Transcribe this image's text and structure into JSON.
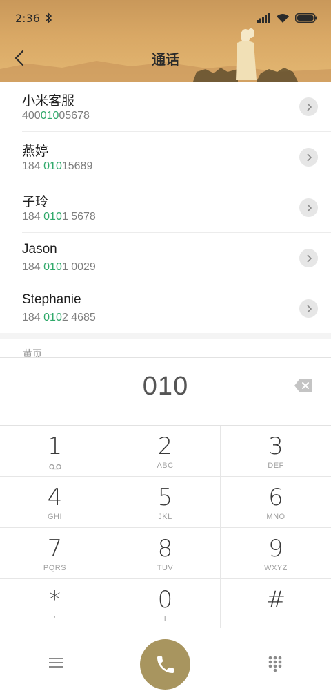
{
  "status_bar": {
    "time": "2:36"
  },
  "header": {
    "title": "通话"
  },
  "results": [
    {
      "name": "小米客服",
      "number_pre": "400",
      "number_match": "010",
      "number_post": "05678"
    },
    {
      "name": "燕婷",
      "number_pre": "184 ",
      "number_match": "010",
      "number_post": "15689"
    },
    {
      "name": "子玲",
      "number_pre": "184 ",
      "number_match": "010",
      "number_post": "1 5678"
    },
    {
      "name": "Jason",
      "number_pre": "184 ",
      "number_match": "010",
      "number_post": "1 0029"
    },
    {
      "name": "Stephanie",
      "number_pre": "184 ",
      "number_match": "010",
      "number_post": "2 4685"
    }
  ],
  "section_label": "黄页",
  "dial": {
    "number": "010"
  },
  "keypad": [
    {
      "digit": "1",
      "letters": ""
    },
    {
      "digit": "2",
      "letters": "ABC"
    },
    {
      "digit": "3",
      "letters": "DEF"
    },
    {
      "digit": "4",
      "letters": "GHI"
    },
    {
      "digit": "5",
      "letters": "JKL"
    },
    {
      "digit": "6",
      "letters": "MNO"
    },
    {
      "digit": "7",
      "letters": "PQRS"
    },
    {
      "digit": "8",
      "letters": "TUV"
    },
    {
      "digit": "9",
      "letters": "WXYZ"
    },
    {
      "digit": "*",
      "letters": "'"
    },
    {
      "digit": "0",
      "letters": "+"
    },
    {
      "digit": "#",
      "letters": ""
    }
  ],
  "icons": {
    "voicemail": "voicemail-icon",
    "back": "back-arrow-icon",
    "backspace": "backspace-icon",
    "menu": "menu-icon",
    "call": "phone-icon",
    "dialpad": "dialpad-icon"
  },
  "colors": {
    "accent_match": "#2fa96a",
    "call_button": "#a8955f",
    "header_gold": "#d9a865"
  }
}
